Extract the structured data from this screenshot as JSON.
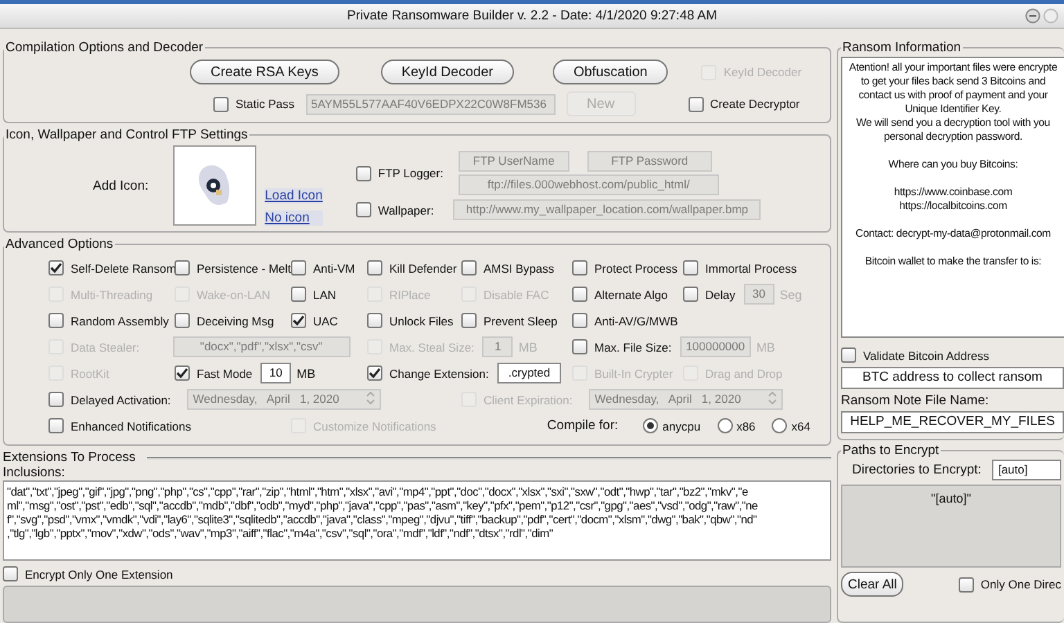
{
  "window": {
    "title": "Private Ransomware Builder v. 2.2 - Date: 4/1/2020 9:27:48 AM"
  },
  "compilation": {
    "title": "Compilation Options and Decoder",
    "buttons": [
      "Create RSA Keys",
      "KeyId Decoder",
      "Obfuscation"
    ],
    "keyid_decoder": {
      "label": "KeyId Decoder",
      "checked": false,
      "disabled": true
    },
    "static_pass": {
      "label": "Static Pass",
      "checked": false,
      "disabled": false
    },
    "static_pass_field": {
      "value": "5AYM55L577AAF40V6EDPX22C0W8FM536",
      "disabled": true
    },
    "new_button": {
      "label": "New",
      "disabled": true
    },
    "create_decryptor": {
      "label": "Create Decryptor",
      "checked": false,
      "disabled": false
    }
  },
  "icon_settings": {
    "title": "Icon, Wallpaper and Control FTP Settings",
    "add_icon_label": "Add Icon:",
    "links": [
      "Load Icon",
      "No icon"
    ],
    "ftp_logger": {
      "label": "FTP Logger:",
      "checked": false,
      "disabled": false
    },
    "ftp_username": {
      "placeholder": "FTP UserName",
      "disabled": true
    },
    "ftp_password": {
      "placeholder": "FTP Password",
      "disabled": true
    },
    "ftp_url": {
      "value": "ftp://files.000webhost.com/public_html/",
      "disabled": true
    },
    "wallpaper": {
      "label": "Wallpaper:",
      "checked": false,
      "disabled": false
    },
    "wallpaper_url": {
      "value": "http://www.my_wallpaper_location.com/wallpaper.bmp",
      "disabled": true
    }
  },
  "advanced": {
    "title": "Advanced Options",
    "rows": [
      [
        {
          "kind": "check",
          "label": "Self-Delete Ransom",
          "checked": true,
          "disabled": false
        },
        {
          "kind": "check",
          "label": "Persistence - Melt",
          "checked": false,
          "disabled": false
        },
        {
          "kind": "check",
          "label": "Anti-VM",
          "checked": false,
          "disabled": false
        },
        {
          "kind": "check",
          "label": "Kill Defender",
          "checked": false,
          "disabled": false
        },
        {
          "kind": "check",
          "label": "AMSI Bypass",
          "checked": false,
          "disabled": false
        },
        {
          "kind": "check",
          "label": "Protect Process",
          "checked": false,
          "disabled": false
        },
        {
          "kind": "check",
          "label": "Immortal Process",
          "checked": false,
          "disabled": false
        }
      ],
      [
        {
          "kind": "check",
          "label": "Multi-Threading",
          "checked": false,
          "disabled": true
        },
        {
          "kind": "check",
          "label": "Wake-on-LAN",
          "checked": false,
          "disabled": true
        },
        {
          "kind": "check",
          "label": "LAN",
          "checked": false,
          "disabled": false
        },
        {
          "kind": "check",
          "label": "RIPlace",
          "checked": false,
          "disabled": true
        },
        {
          "kind": "check",
          "label": "Disable FAC",
          "checked": false,
          "disabled": true
        },
        {
          "kind": "check",
          "label": "Alternate Algo",
          "checked": false,
          "disabled": false
        },
        {
          "kind": "check_field",
          "label": "Delay",
          "checked": false,
          "disabled": false,
          "value": "30",
          "field_disabled": true,
          "unit": "Seg"
        }
      ],
      [
        {
          "kind": "check",
          "label": "Random Assembly",
          "checked": false,
          "disabled": false
        },
        {
          "kind": "check",
          "label": "Deceiving Msg",
          "checked": false,
          "disabled": false
        },
        {
          "kind": "check",
          "label": "UAC",
          "checked": true,
          "disabled": false
        },
        {
          "kind": "check",
          "label": "Unlock Files",
          "checked": false,
          "disabled": false
        },
        {
          "kind": "check",
          "label": "Prevent Sleep",
          "checked": false,
          "disabled": false
        },
        {
          "kind": "check",
          "label": "Anti-AV/G/MWB",
          "checked": false,
          "disabled": false
        }
      ],
      [
        {
          "kind": "check_field",
          "label": "Data Stealer:",
          "checked": false,
          "disabled": true,
          "value": "\"docx\",\"pdf\",\"xlsx\",\"csv\"",
          "field_disabled": true
        },
        {
          "kind": "check_field",
          "label": "Max. Steal Size:",
          "checked": false,
          "disabled": true,
          "value": "1",
          "field_disabled": true,
          "unit": "MB"
        },
        {
          "kind": "check_field",
          "label": "Max. File Size:",
          "checked": false,
          "disabled": false,
          "value": "100000000",
          "field_disabled": true,
          "unit": "MB"
        }
      ],
      [
        {
          "kind": "check",
          "label": "RootKit",
          "checked": false,
          "disabled": true
        },
        {
          "kind": "check_field",
          "label": "Fast Mode",
          "checked": true,
          "disabled": false,
          "value": "10",
          "field_disabled": false,
          "unit": "MB"
        },
        "",
        {
          "kind": "check_field",
          "label": "Change Extension:",
          "checked": true,
          "disabled": false,
          "value": ".crypted",
          "field_disabled": false
        },
        "",
        {
          "kind": "check",
          "label": "Built-In Crypter",
          "checked": false,
          "disabled": true
        },
        {
          "kind": "check",
          "label": "Drag and Drop",
          "checked": false,
          "disabled": true
        }
      ],
      [
        {
          "kind": "date",
          "label": "Delayed Activation:",
          "checked": false,
          "disabled": false,
          "value": "Wednesday,   April   1, 2020",
          "field_disabled": true
        },
        {
          "kind": "date",
          "label": "Client Expiration:",
          "checked": false,
          "disabled": true,
          "value": "Wednesday,   April   1, 2020",
          "field_disabled": true
        }
      ],
      [
        {
          "kind": "check",
          "label": "Enhanced Notifications",
          "checked": false,
          "disabled": false
        },
        {
          "kind": "check",
          "label": "Customize Notifications",
          "checked": false,
          "disabled": true
        },
        {
          "kind": "radio_group",
          "label": "Compile for:",
          "options": [
            {
              "label": "anycpu",
              "selected": true
            },
            {
              "label": "x86",
              "selected": false
            },
            {
              "label": "x64",
              "selected": false
            }
          ]
        }
      ]
    ]
  },
  "extensions": {
    "title": "Extensions To Process",
    "inclusions_label": "Inclusions:",
    "lines": [
      "\"dat\",\"txt\",\"jpeg\",\"gif\",\"jpg\",\"png\",\"php\",\"cs\",\"cpp\",\"rar\",\"zip\",\"html\",\"htm\",\"xlsx\",\"avi\",\"mp4\",\"ppt\",\"doc\",\"docx\",\"xlsx\",\"sxi\",\"sxw\",\"odt\",\"hwp\",\"tar\",\"bz2\",\"mkv\",\"e",
      "ml\",\"msg\",\"ost\",\"pst\",\"edb\",\"sql\",\"accdb\",\"mdb\",\"dbf\",\"odb\",\"myd\",\"php\",\"java\",\"cpp\",\"pas\",\"asm\",\"key\",\"pfx\",\"pem\",\"p12\",\"csr\",\"gpg\",\"aes\",\"vsd\",\"odg\",\"raw\",\"ne",
      "f\",\"svg\",\"psd\",\"vmx\",\"vmdk\",\"vdi\",\"lay6\",\"sqlite3\",\"sqlitedb\",\"accdb\",\"java\",\"class\",\"mpeg\",\"djvu\",\"tiff\",\"backup\",\"pdf\",\"cert\",\"docm\",\"xlsm\",\"dwg\",\"bak\",\"qbw\",\"nd\"",
      ",\"tlg\",\"lgb\",\"pptx\",\"mov\",\"xdw\",\"ods\",\"wav\",\"mp3\",\"aiff\",\"flac\",\"m4a\",\"csv\",\"sql\",\"ora\",\"mdf\",\"ldf\",\"ndf\",\"dtsx\",\"rdl\",\"dim\""
    ],
    "encrypt_one": {
      "label": "Encrypt Only One Extension",
      "checked": false,
      "disabled": false
    }
  },
  "ransom_info": {
    "title": "Ransom Information",
    "paragraphs": [
      [
        "Atention! all your important files were encrypte",
        "to get your files back send 3 Bitcoins and",
        "contact us with proof of payment and your",
        "Unique Identifier Key.",
        "We will send you a decryption tool with you",
        "personal decryption password."
      ],
      [
        "Where can you buy Bitcoins:"
      ],
      [
        "https://www.coinbase.com",
        "https://localbitcoins.com"
      ],
      [
        "Contact: decrypt-my-data@protonmail.com"
      ],
      [
        "Bitcoin wallet to make the transfer to is:"
      ]
    ],
    "validate": {
      "label": "Validate Bitcoin Address",
      "checked": false,
      "disabled": false
    },
    "btc_field": {
      "value": "BTC address to collect ransom"
    },
    "note_label": "Ransom Note File Name:",
    "note_field": {
      "value": "HELP_ME_RECOVER_MY_FILES"
    }
  },
  "paths": {
    "title": "Paths to Encrypt",
    "dir_label": "Directories to Encrypt:",
    "dir_field": {
      "value": "[auto]"
    },
    "list": [
      "\"[auto]\""
    ],
    "clear_button": "Clear All",
    "only_one": {
      "label": "Only One Direc",
      "checked": false,
      "disabled": false
    }
  }
}
